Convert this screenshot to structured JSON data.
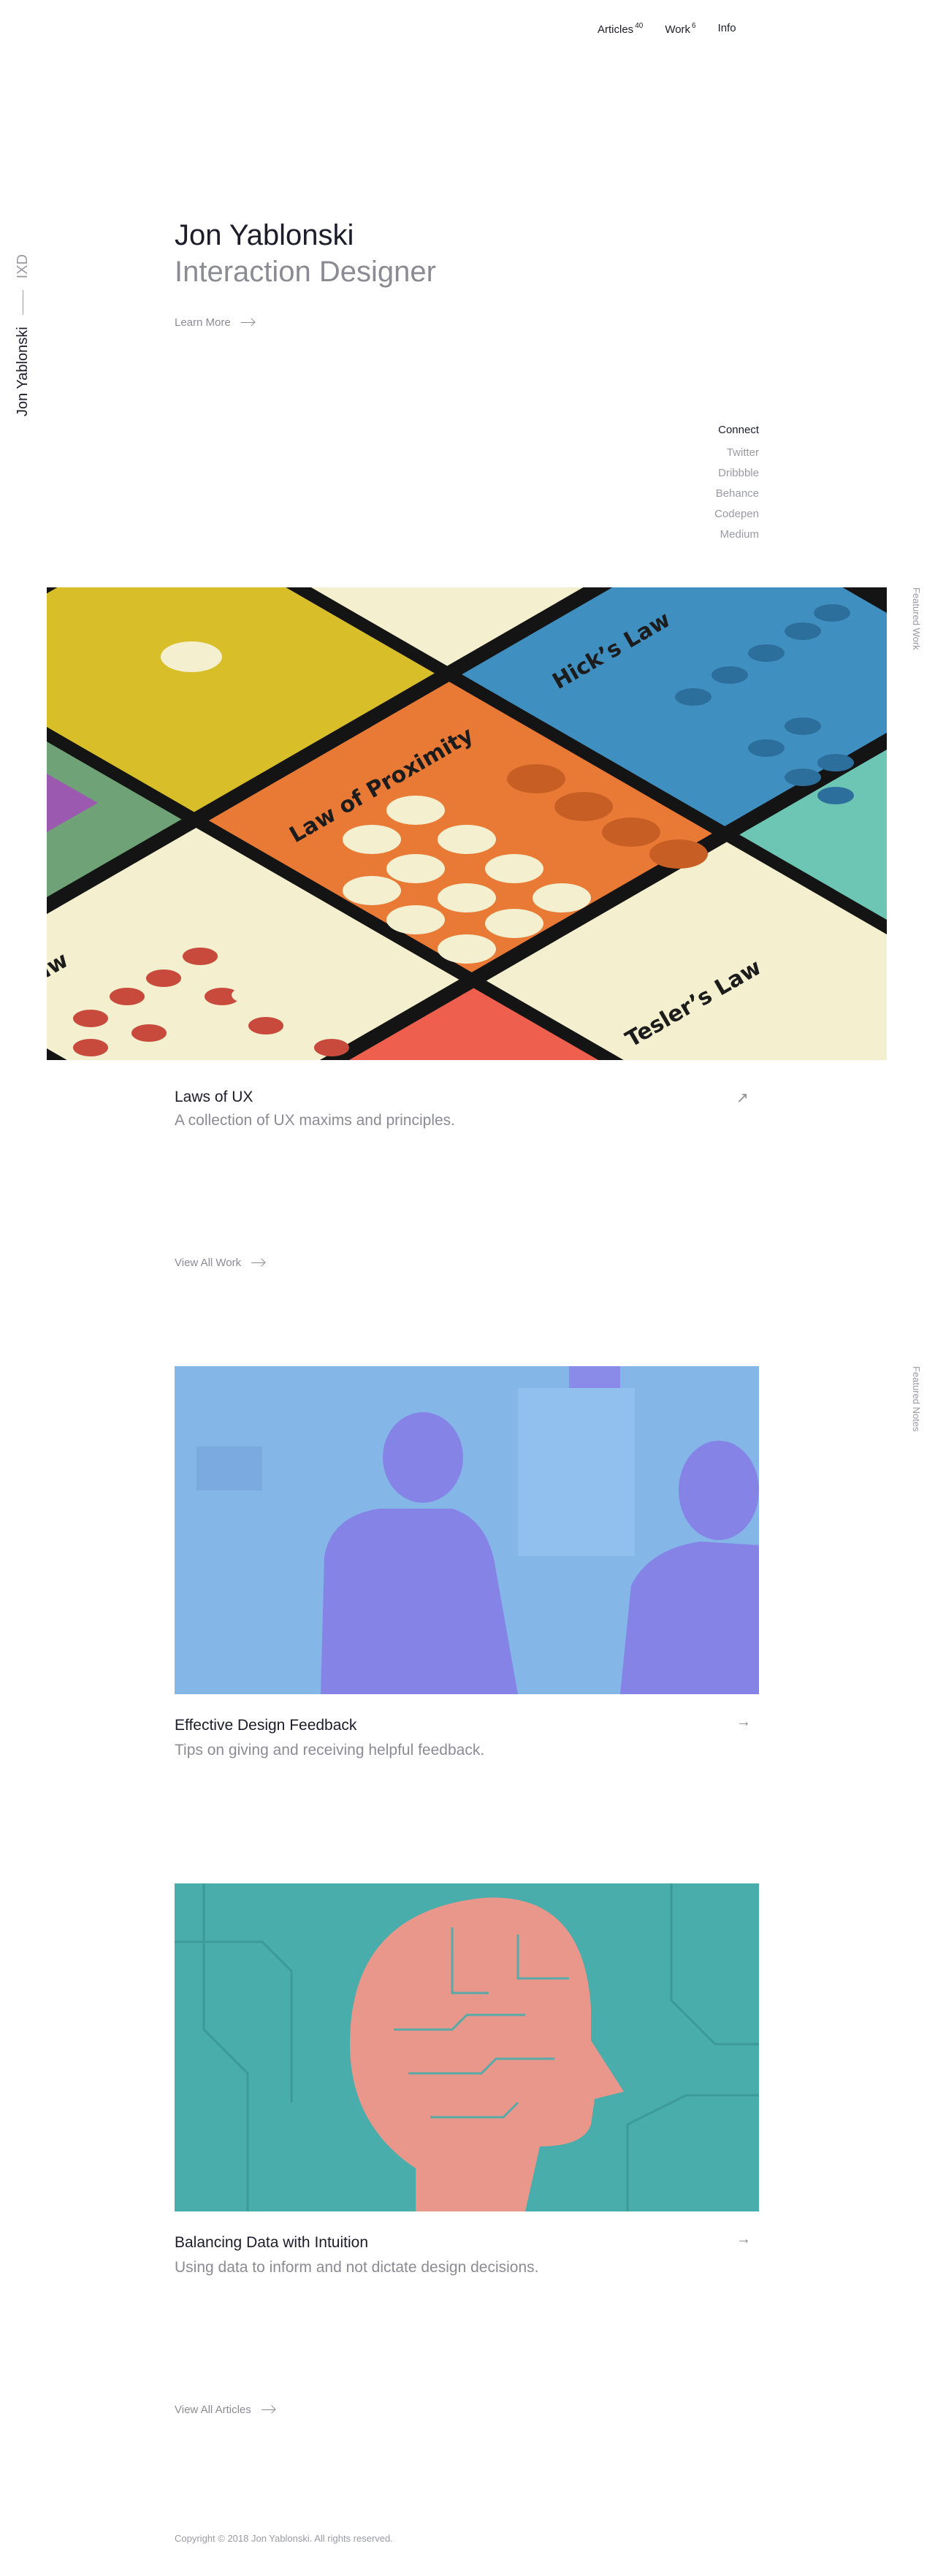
{
  "nav": {
    "articles_label": "Articles",
    "articles_count": "40",
    "work_label": "Work",
    "work_count": "6",
    "info_label": "Info"
  },
  "side": {
    "name": "Jon Yablonski",
    "role": "IXD"
  },
  "hero": {
    "name": "Jon Yablonski",
    "title": "Interaction Designer",
    "cta": "Learn More"
  },
  "connect": {
    "heading": "Connect",
    "links": [
      "Twitter",
      "Dribbble",
      "Behance",
      "Codepen",
      "Medium"
    ]
  },
  "featured_work": {
    "label": "Featured Work",
    "title": "Laws of UX",
    "subtitle": "A collection of UX maxims and principles.",
    "image_labels": [
      "Hick’s Law",
      "Law of Proximity",
      "Tesler’s Law",
      "aw"
    ],
    "view_all": "View All Work"
  },
  "featured_notes": {
    "label": "Featured Notes",
    "items": [
      {
        "title": "Effective Design Feedback",
        "subtitle": "Tips on giving and receiving helpful feedback."
      },
      {
        "title": "Balancing Data with Intuition",
        "subtitle": "Using data to inform and not dictate design decisions."
      }
    ],
    "view_all": "View All Articles"
  },
  "footer": {
    "copyright": "Copyright © 2018 Jon Yablonski. All rights reserved."
  },
  "colors": {
    "text": "#1c1c2b",
    "muted": "#8b8b94",
    "green": "#6fa277",
    "orange": "#e97a35",
    "blue": "#3f8fc1",
    "red": "#ee5f4e",
    "cream": "#f4efcf",
    "teal": "#6dc6b3",
    "purple": "#9b5ab0",
    "feedback_blue": "#84b6e8",
    "circuit_teal": "#48adab",
    "circuit_pink": "#e9978b"
  }
}
